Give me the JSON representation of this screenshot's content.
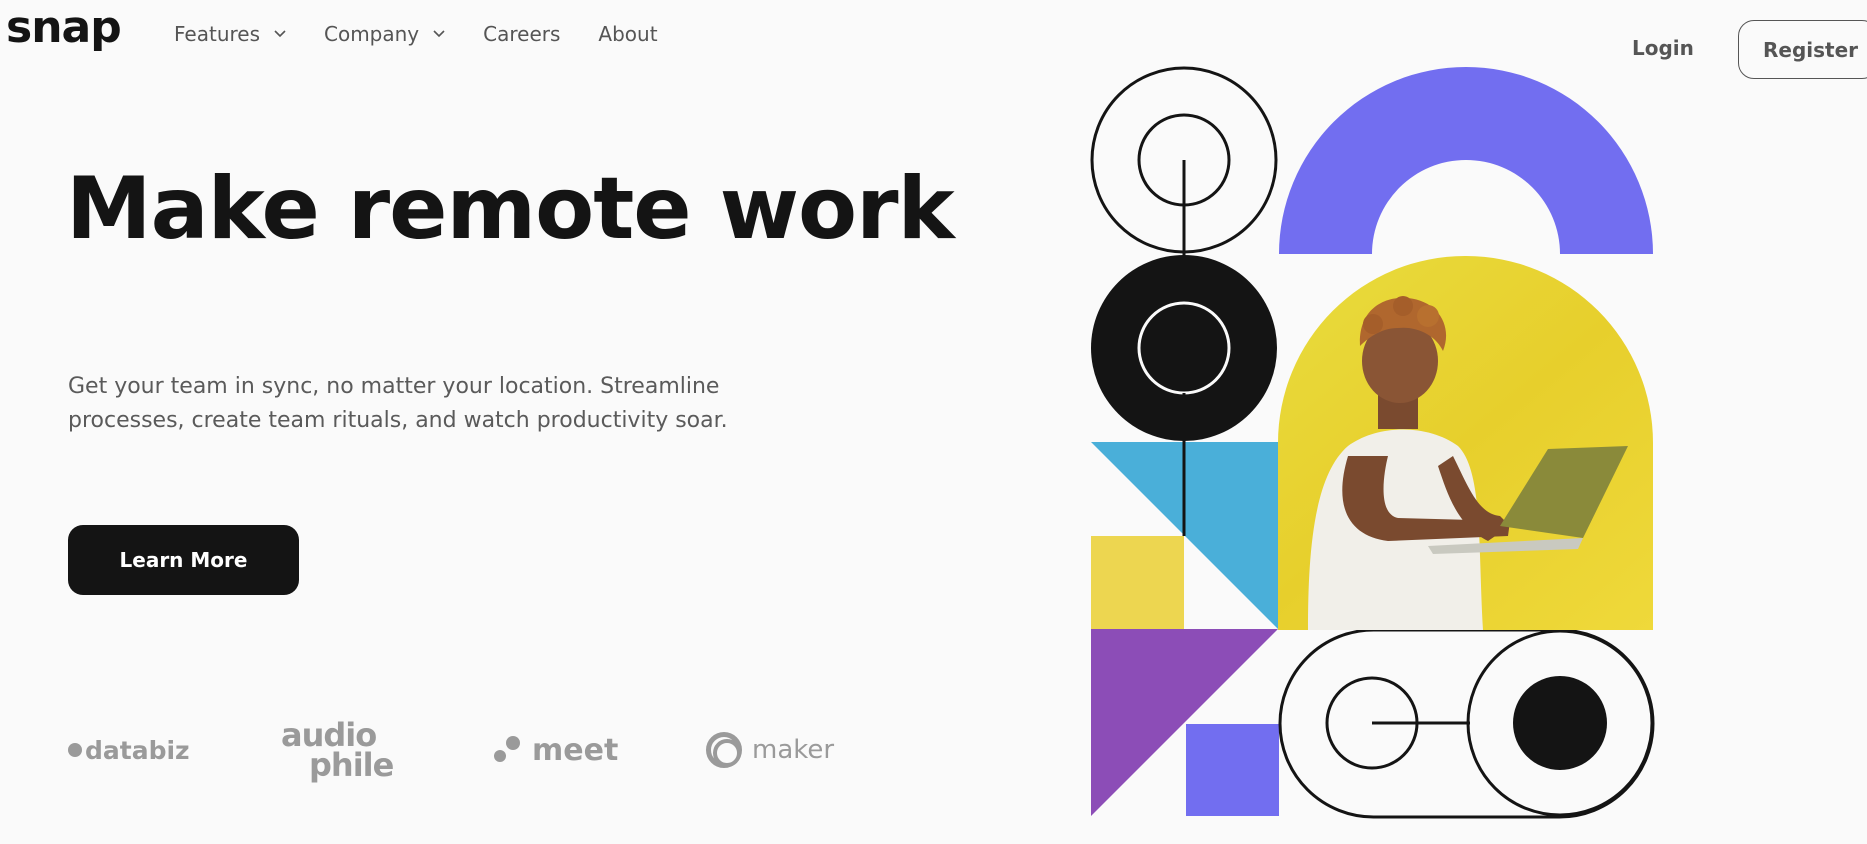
{
  "brand": {
    "logo": "snap"
  },
  "nav": {
    "items": [
      {
        "label": "Features",
        "has_dropdown": true
      },
      {
        "label": "Company",
        "has_dropdown": true
      },
      {
        "label": "Careers",
        "has_dropdown": false
      },
      {
        "label": "About",
        "has_dropdown": false
      }
    ]
  },
  "auth": {
    "login_label": "Login",
    "register_label": "Register"
  },
  "hero": {
    "title": "Make remote work",
    "description": "Get your team in sync, no matter your location. Streamline processes, create team rituals, and watch productivity soar.",
    "cta_label": "Learn More"
  },
  "clients": {
    "databiz": "databiz",
    "audiophile_top": "audio",
    "audiophile_bottom": "phile",
    "meet": "meet",
    "maker": "maker"
  },
  "colors": {
    "ink": "#141414",
    "purple": "#726ef0",
    "violet": "#8c4db7",
    "blue": "#4aafd9",
    "yellow": "#edd650"
  }
}
